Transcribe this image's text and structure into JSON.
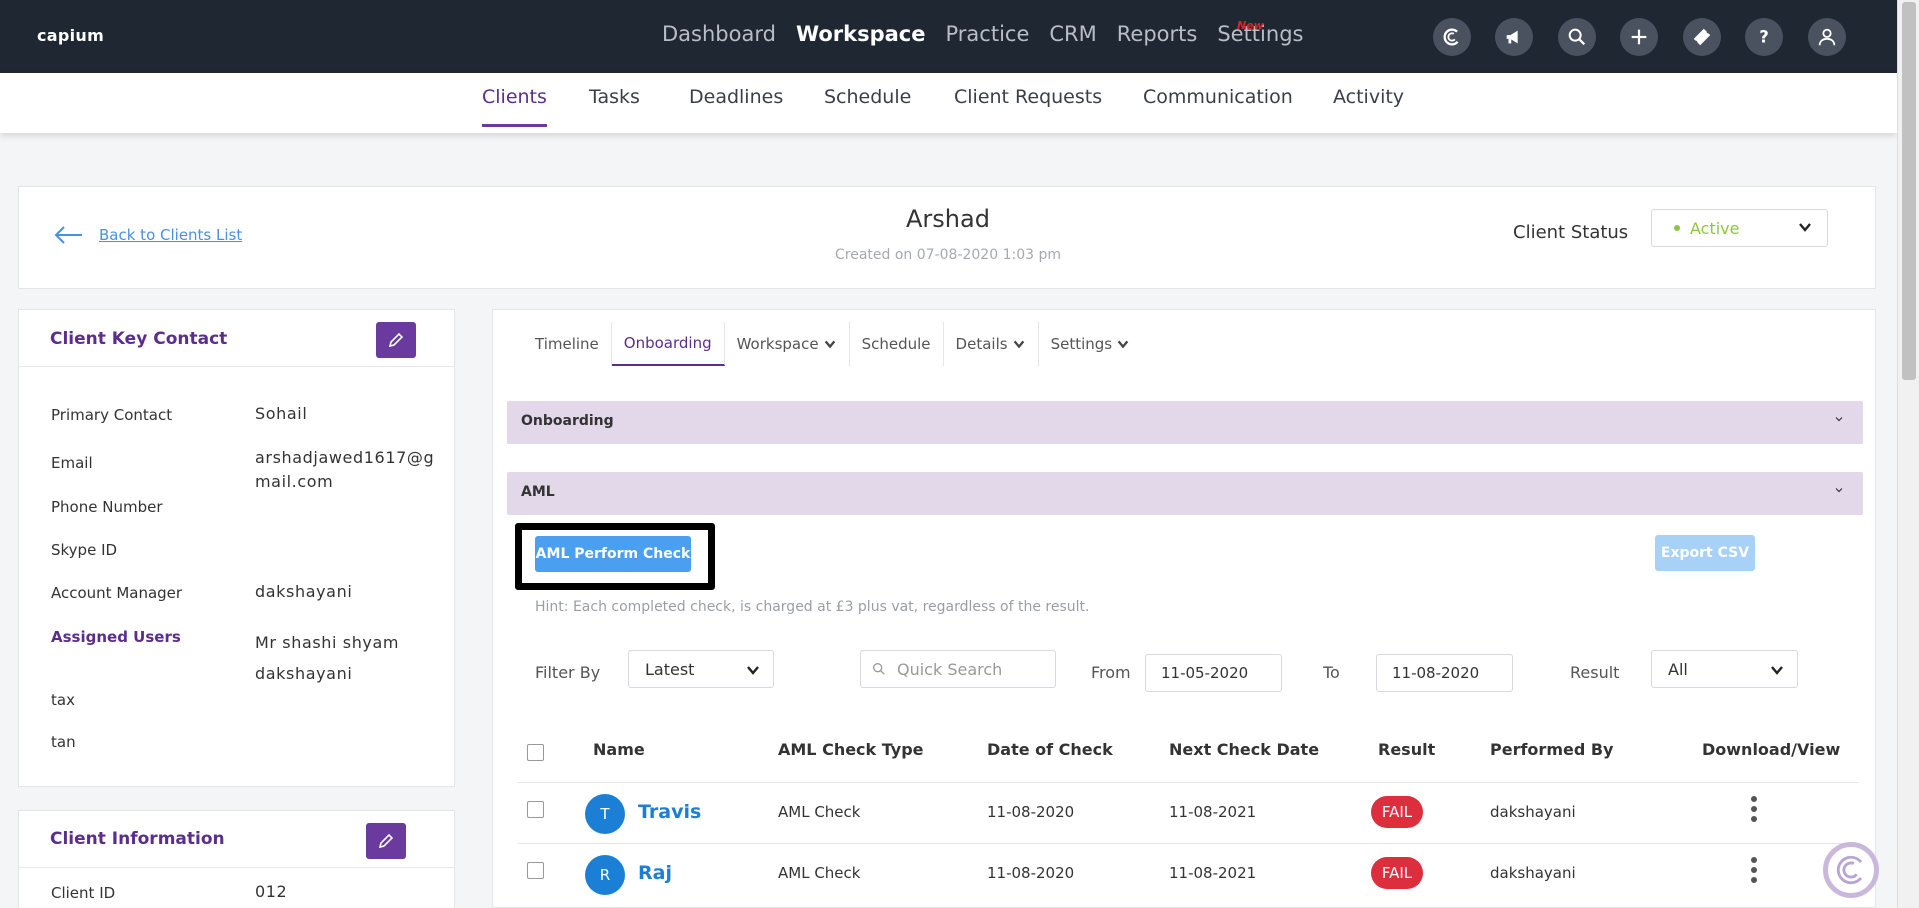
{
  "app": {
    "logo": "capium"
  },
  "mainnav": {
    "items": [
      "Dashboard",
      "Workspace",
      "Practice",
      "CRM",
      "Reports",
      "Settings"
    ],
    "active": "Workspace",
    "new_badge": "New"
  },
  "header_icons": [
    "capium-icon",
    "megaphone-icon",
    "search-icon",
    "plus-icon",
    "ticket-icon",
    "help-icon",
    "user-icon"
  ],
  "subnav": {
    "items": [
      "Clients",
      "Tasks",
      "Deadlines",
      "Schedule",
      "Client Requests",
      "Communication",
      "Activity"
    ],
    "active": "Clients"
  },
  "client_header": {
    "back_label": "Back to Clients List",
    "name": "Arshad",
    "created": "Created on 07-08-2020 1:03 pm",
    "status_label": "Client Status",
    "status_value": "Active",
    "status_color": "#8dc63f"
  },
  "key_contact": {
    "title": "Client Key Contact",
    "fields": [
      {
        "label": "Primary Contact",
        "value": "Sohail"
      },
      {
        "label": "Email",
        "value": "arshadjawed1617@g mail.com"
      },
      {
        "label": "Phone Number",
        "value": ""
      },
      {
        "label": "Skype ID",
        "value": ""
      },
      {
        "label": "Account Manager",
        "value": "dakshayani"
      }
    ],
    "assigned_users_label": "Assigned Users",
    "assigned_users": [
      "Mr shashi shyam",
      "dakshayani"
    ],
    "extra_labels": [
      "tax",
      "tan"
    ]
  },
  "client_info": {
    "title": "Client Information",
    "fields": [
      {
        "label": "Client ID",
        "value": "012"
      }
    ]
  },
  "tabs": [
    {
      "label": "Timeline",
      "dropdown": false
    },
    {
      "label": "Onboarding",
      "dropdown": false
    },
    {
      "label": "Workspace",
      "dropdown": true
    },
    {
      "label": "Schedule",
      "dropdown": false
    },
    {
      "label": "Details",
      "dropdown": true
    },
    {
      "label": "Settings",
      "dropdown": true
    }
  ],
  "active_tab": "Onboarding",
  "accordions": [
    "Onboarding",
    "AML"
  ],
  "aml": {
    "perform_button": "AML Perform Check",
    "export_button": "Export CSV",
    "hint": "Hint: Each completed check, is charged at £3 plus vat, regardless of the result."
  },
  "filters": {
    "filter_by_label": "Filter By",
    "filter_by_value": "Latest",
    "search_placeholder": "Quick Search",
    "from_label": "From",
    "from_value": "11-05-2020",
    "to_label": "To",
    "to_value": "11-08-2020",
    "result_label": "Result",
    "result_value": "All"
  },
  "table": {
    "columns": [
      "Name",
      "AML Check Type",
      "Date of Check",
      "Next Check Date",
      "Result",
      "Performed By",
      "Download/View"
    ],
    "rows": [
      {
        "initial": "T",
        "name": "Travis",
        "type": "AML Check",
        "date": "11-08-2020",
        "next": "11-08-2021",
        "result": "FAIL",
        "by": "dakshayani"
      },
      {
        "initial": "R",
        "name": "Raj",
        "type": "AML Check",
        "date": "11-08-2020",
        "next": "11-08-2021",
        "result": "FAIL",
        "by": "dakshayani"
      }
    ]
  },
  "colors": {
    "brand_purple": "#5b2e8c",
    "primary_blue": "#4a9ff0",
    "fail_red": "#dc2e3d",
    "topbar": "#1f2733"
  }
}
